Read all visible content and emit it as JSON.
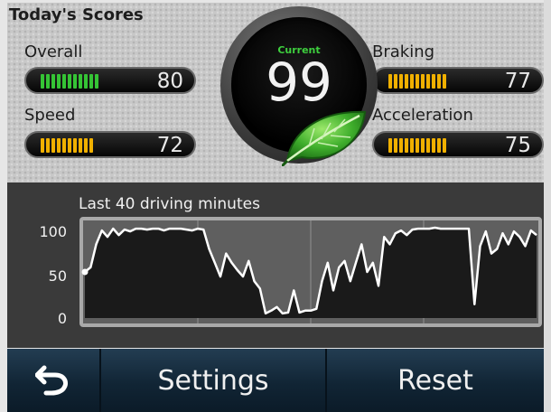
{
  "title": "Today's Scores",
  "dial": {
    "label": "Current",
    "value": "99",
    "leaf_icon": "leaf-icon"
  },
  "scores": {
    "overall": {
      "label": "Overall",
      "value": "80",
      "level": 0.8,
      "color": "#35c435"
    },
    "speed": {
      "label": "Speed",
      "value": "72",
      "level": 0.72,
      "color": "#f0b000"
    },
    "braking": {
      "label": "Braking",
      "value": "77",
      "level": 0.77,
      "color": "#f0b000"
    },
    "acceleration": {
      "label": "Acceleration",
      "value": "75",
      "level": 0.75,
      "color": "#f0b000"
    }
  },
  "graph": {
    "title": "Last 40 driving minutes",
    "y_ticks": [
      "100",
      "50",
      "0"
    ]
  },
  "chart_data": {
    "type": "line",
    "title": "Last 40 driving minutes",
    "xlabel": "",
    "ylabel": "",
    "ylim": [
      0,
      100
    ],
    "x": [
      0,
      0.5,
      1,
      1.5,
      2,
      2.5,
      3,
      3.5,
      4,
      4.5,
      5,
      5.5,
      6,
      6.5,
      7,
      7.5,
      8,
      8.5,
      9,
      9.5,
      10,
      10.5,
      11,
      11.5,
      12,
      12.5,
      13,
      13.5,
      14,
      14.5,
      15,
      15.5,
      16,
      16.5,
      17,
      17.5,
      18,
      18.5,
      19,
      19.5,
      20,
      20.5,
      21,
      21.5,
      22,
      22.5,
      23,
      23.5,
      24,
      24.5,
      25,
      25.5,
      26,
      26.5,
      27,
      27.5,
      28,
      28.5,
      29,
      29.5,
      30,
      30.5,
      31,
      31.5,
      32,
      32.5,
      33,
      33.5,
      34,
      34.5,
      35,
      35.5,
      36,
      36.5,
      37,
      37.5,
      38,
      38.5,
      39,
      39.5,
      40
    ],
    "series": [
      {
        "values": [
          50,
          55,
          80,
          95,
          88,
          97,
          90,
          96,
          94,
          97,
          97,
          96,
          97,
          97,
          95,
          97,
          97,
          97,
          96,
          95,
          97,
          96,
          75,
          60,
          45,
          70,
          60,
          52,
          45,
          62,
          40,
          32,
          5,
          8,
          12,
          5,
          6,
          30,
          6,
          8,
          8,
          10,
          40,
          60,
          30,
          55,
          62,
          40,
          60,
          80,
          50,
          60,
          35,
          88,
          80,
          92,
          95,
          90,
          96,
          97,
          97,
          97,
          98,
          97,
          97,
          97,
          97,
          97,
          97,
          15,
          78,
          94,
          70,
          75,
          92,
          80,
          94,
          88,
          78,
          95,
          90
        ]
      }
    ]
  },
  "bottom": {
    "back_icon": "back-arrow-icon",
    "settings_label": "Settings",
    "reset_label": "Reset"
  },
  "colors": {
    "green_accent": "#35c435",
    "amber_accent": "#f0b000",
    "button_bar": "#15293a"
  }
}
